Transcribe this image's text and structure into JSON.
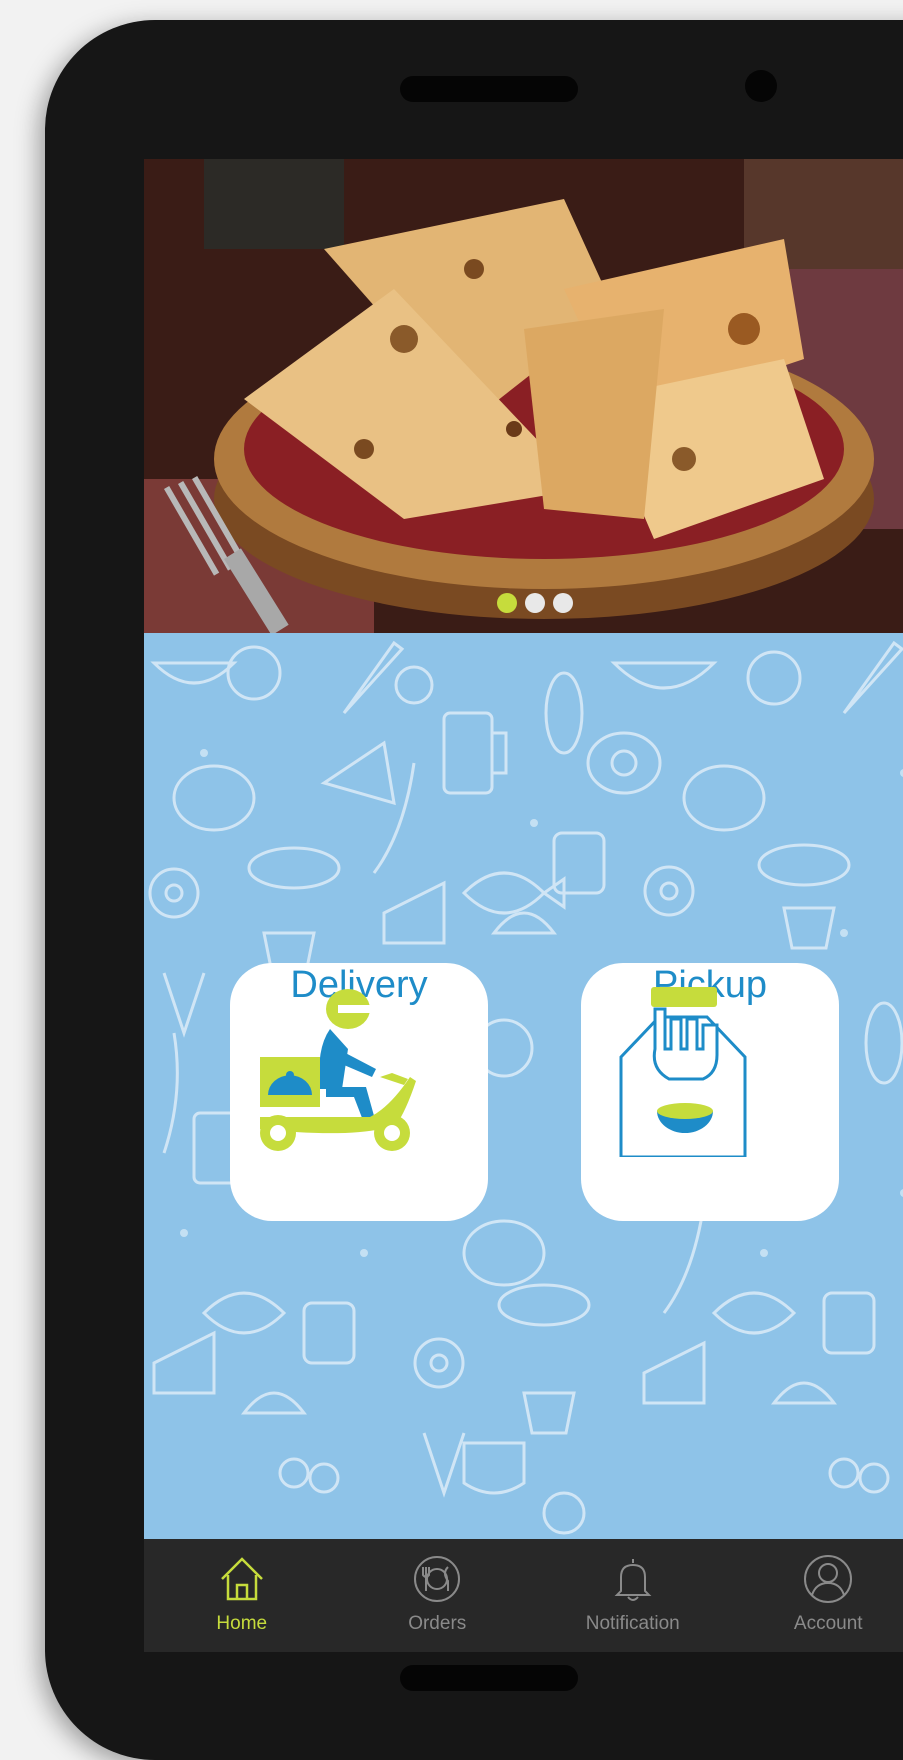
{
  "hero": {
    "image_alt": "basket of naan bread",
    "slides": 3,
    "active_slide": 1,
    "active_dot_color": "#c6dc3c"
  },
  "services": [
    {
      "label": "Delivery",
      "icon": "delivery-scooter-icon"
    },
    {
      "label": "Pickup",
      "icon": "takeaway-bag-icon"
    }
  ],
  "nav": {
    "items": [
      {
        "label": "Home",
        "icon": "home-icon",
        "active": true
      },
      {
        "label": "Orders",
        "icon": "plate-cutlery-icon",
        "active": false
      },
      {
        "label": "Notification",
        "icon": "bell-icon",
        "active": false
      },
      {
        "label": "Account",
        "icon": "user-icon",
        "active": false
      }
    ]
  },
  "colors": {
    "accent": "#c6dc3c",
    "primary_blue": "#1e8cc8",
    "background_blue": "#8ec3e8",
    "nav_background": "#282828"
  }
}
